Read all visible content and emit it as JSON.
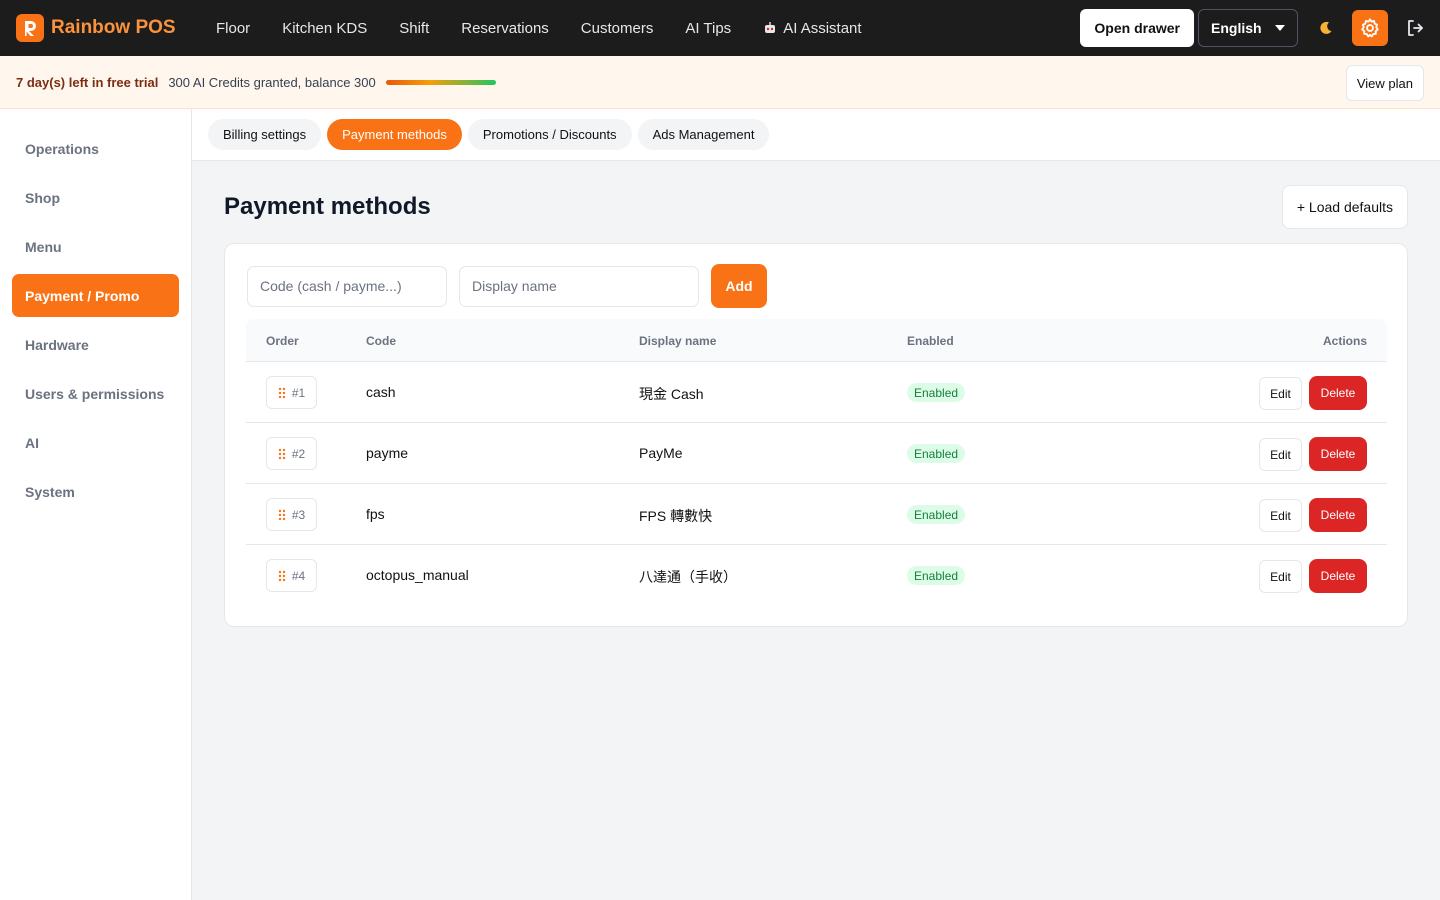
{
  "brand": {
    "name": "Rainbow POS"
  },
  "nav": {
    "items": [
      {
        "label": "Floor"
      },
      {
        "label": "Kitchen KDS"
      },
      {
        "label": "Shift"
      },
      {
        "label": "Reservations"
      },
      {
        "label": "Customers"
      },
      {
        "label": "AI Tips"
      }
    ],
    "ai_assistant_label": "AI Assistant"
  },
  "topbar": {
    "open_drawer_label": "Open drawer",
    "language": "English"
  },
  "trial": {
    "days_left": "7 day(s) left in free trial",
    "credits": "300 AI Credits granted, balance 300",
    "credits_fraction": 1.0,
    "view_plan_label": "View plan"
  },
  "sidebar": {
    "items": [
      {
        "label": "Operations"
      },
      {
        "label": "Shop"
      },
      {
        "label": "Menu"
      },
      {
        "label": "Payment / Promo",
        "active": true
      },
      {
        "label": "Hardware"
      },
      {
        "label": "Users & permissions"
      },
      {
        "label": "AI"
      },
      {
        "label": "System"
      }
    ]
  },
  "subtabs": {
    "items": [
      {
        "label": "Billing settings"
      },
      {
        "label": "Payment methods",
        "active": true
      },
      {
        "label": "Promotions / Discounts"
      },
      {
        "label": "Ads Management"
      }
    ]
  },
  "main": {
    "title": "Payment methods",
    "load_defaults_label": "+ Load defaults",
    "form": {
      "code_placeholder": "Code (cash / payme...)",
      "name_placeholder": "Display name",
      "add_label": "Add"
    },
    "table": {
      "headers": {
        "order": "Order",
        "code": "Code",
        "display_name": "Display name",
        "enabled": "Enabled",
        "actions": "Actions"
      },
      "rows": [
        {
          "order": "#1",
          "code": "cash",
          "display_name": "現金 Cash",
          "status": "Enabled",
          "edit": "Edit",
          "delete": "Delete"
        },
        {
          "order": "#2",
          "code": "payme",
          "display_name": "PayMe",
          "status": "Enabled",
          "edit": "Edit",
          "delete": "Delete"
        },
        {
          "order": "#3",
          "code": "fps",
          "display_name": "FPS 轉數快",
          "status": "Enabled",
          "edit": "Edit",
          "delete": "Delete"
        },
        {
          "order": "#4",
          "code": "octopus_manual",
          "display_name": "八達通（手收）",
          "status": "Enabled",
          "edit": "Edit",
          "delete": "Delete"
        }
      ]
    }
  },
  "colors": {
    "accent": "#f97316",
    "topbar_bg": "#1c1c1c",
    "danger": "#dc2626",
    "success_bg": "#dcfce7",
    "success_text": "#15803d"
  },
  "icons": {
    "logo": "rainbow-pos-logo",
    "ai_assistant": "robot-icon",
    "theme": "moon-icon",
    "settings": "gear-icon",
    "logout": "logout-icon",
    "drag": "drag-handle-icon",
    "dropdown": "chevron-down-icon"
  }
}
